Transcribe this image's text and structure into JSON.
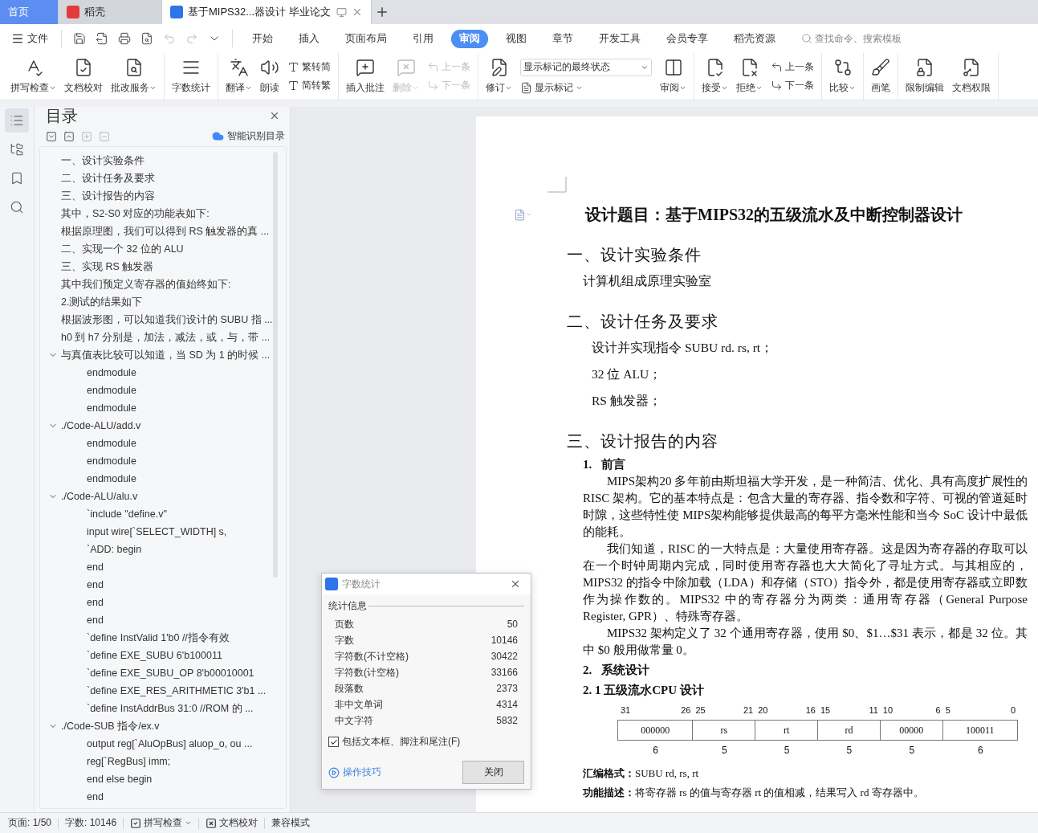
{
  "tabs": [
    {
      "kind": "home",
      "label": "首页",
      "selected": false
    },
    {
      "kind": "app",
      "label": "稻壳",
      "selected": false
    },
    {
      "kind": "doc",
      "label": "基于MIPS32...器设计 毕业论文",
      "selected": true
    }
  ],
  "menu": {
    "file_label": "文件",
    "search_placeholder": "查找命令、搜索模板",
    "tabs": [
      {
        "label": "开始",
        "selected": false
      },
      {
        "label": "插入",
        "selected": false
      },
      {
        "label": "页面布局",
        "selected": false
      },
      {
        "label": "引用",
        "selected": false
      },
      {
        "label": "审阅",
        "selected": true
      },
      {
        "label": "视图",
        "selected": false
      },
      {
        "label": "章节",
        "selected": false
      },
      {
        "label": "开发工具",
        "selected": false
      },
      {
        "label": "会员专享",
        "selected": false
      },
      {
        "label": "稻壳资源",
        "selected": false
      }
    ]
  },
  "ribbon": [
    {
      "items": [
        {
          "kind": "big",
          "label": "拼写检查",
          "dropdown": true,
          "disabled": false
        },
        {
          "kind": "big",
          "label": "文档校对",
          "dropdown": false,
          "disabled": false
        },
        {
          "kind": "big",
          "label": "批改服务",
          "dropdown": true,
          "disabled": false
        }
      ]
    },
    {
      "items": [
        {
          "kind": "big",
          "label": "字数统计",
          "dropdown": false,
          "disabled": false
        }
      ]
    },
    {
      "items": [
        {
          "kind": "big",
          "label": "翻译",
          "dropdown": true,
          "disabled": false
        },
        {
          "kind": "big",
          "label": "朗读",
          "dropdown": false,
          "disabled": false
        },
        {
          "kind": "pair",
          "rows": [
            {
              "label": "繁转简",
              "disabled": false
            },
            {
              "label": "简转繁",
              "disabled": false
            }
          ]
        }
      ]
    },
    {
      "items": [
        {
          "kind": "big",
          "label": "插入批注",
          "dropdown": false,
          "disabled": false
        },
        {
          "kind": "big",
          "label": "删除",
          "dropdown": true,
          "disabled": true
        },
        {
          "kind": "pair",
          "rows": [
            {
              "label": "上一条",
              "disabled": true
            },
            {
              "label": "下一条",
              "disabled": true
            }
          ]
        }
      ]
    },
    {
      "items": [
        {
          "kind": "big",
          "label": "修订",
          "dropdown": true,
          "disabled": false
        },
        {
          "kind": "select",
          "value": "显示标记的最终状态",
          "label": "显示标记"
        },
        {
          "kind": "big",
          "label": "审阅",
          "dropdown": true,
          "disabled": false
        }
      ]
    },
    {
      "items": [
        {
          "kind": "big",
          "label": "接受",
          "dropdown": true,
          "disabled": false
        },
        {
          "kind": "big",
          "label": "拒绝",
          "dropdown": true,
          "disabled": false
        },
        {
          "kind": "pair",
          "rows": [
            {
              "label": "上一条",
              "disabled": false
            },
            {
              "label": "下一条",
              "disabled": false
            }
          ]
        }
      ]
    },
    {
      "items": [
        {
          "kind": "big",
          "label": "比较",
          "dropdown": true,
          "disabled": false
        }
      ]
    },
    {
      "items": [
        {
          "kind": "big",
          "label": "画笔",
          "dropdown": false,
          "disabled": false
        }
      ]
    },
    {
      "items": [
        {
          "kind": "big",
          "label": "限制编辑",
          "dropdown": false,
          "disabled": false
        },
        {
          "kind": "big",
          "label": "文档权限",
          "dropdown": false,
          "disabled": false
        }
      ]
    }
  ],
  "rail_tabs": [
    {
      "selected": true
    },
    {
      "selected": false
    },
    {
      "selected": false
    },
    {
      "selected": false
    }
  ],
  "toc": {
    "title": "目录",
    "smart_label": "智能识别目录",
    "items": [
      {
        "text": "一、设计实验条件"
      },
      {
        "text": "二、设计任务及要求"
      },
      {
        "text": "三、设计报告的内容"
      },
      {
        "text": "其中，S2-S0 对应的功能表如下:"
      },
      {
        "text": "根据原理图，我们可以得到 RS 触发器的真 ..."
      },
      {
        "text": "二、实现一个 32 位的 ALU"
      },
      {
        "text": "三、实现 RS 触发器"
      },
      {
        "text": "其中我们预定义寄存器的值始终如下:"
      },
      {
        "text": "2.测试的结果如下"
      },
      {
        "text": "根据波形图，可以知道我们设计的 SUBU 指 ..."
      },
      {
        "text": "h0 到 h7 分别是，加法，减法，或，与，带 ..."
      },
      {
        "text": "与真值表比较可以知道，当 SD 为 1 的时候 ...",
        "expanded": true,
        "children": [
          {
            "text": "endmodule"
          },
          {
            "text": "endmodule"
          },
          {
            "text": "endmodule"
          }
        ]
      },
      {
        "text": "./Code-ALU/add.v",
        "expanded": true,
        "children": [
          {
            "text": "endmodule"
          },
          {
            "text": "endmodule"
          },
          {
            "text": "endmodule"
          }
        ]
      },
      {
        "text": "./Code-ALU/alu.v",
        "expanded": true,
        "children": [
          {
            "text": "`include \"define.v\""
          },
          {
            "text": "input wire[`SELECT_WIDTH] s,"
          },
          {
            "text": "`ADD: begin"
          },
          {
            "text": "end"
          },
          {
            "text": "end"
          },
          {
            "text": "end"
          },
          {
            "text": "end"
          },
          {
            "text": "`define InstValid 1'b0  //指令有效"
          },
          {
            "text": "`define EXE_SUBU 6'b100011"
          },
          {
            "text": "`define EXE_SUBU_OP 8'b00010001"
          },
          {
            "text": "`define EXE_RES_ARITHMETIC 3'b1 ..."
          },
          {
            "text": "`define InstAddrBus 31:0 //ROM 的 ..."
          }
        ]
      },
      {
        "text": "./Code-SUB 指令/ex.v",
        "expanded": true,
        "children": [
          {
            "text": "output reg[`AluOpBus] aluop_o, ou ..."
          },
          {
            "text": "reg[`RegBus]  imm;"
          },
          {
            "text": "end else begin"
          },
          {
            "text": "end"
          }
        ]
      }
    ]
  },
  "document": {
    "blocks": [
      {
        "kind": "title",
        "text": "设计题目：基于MIPS32的五级流水及中断控制器设计"
      },
      {
        "kind": "heading",
        "text": "一、设计实验条件"
      },
      {
        "kind": "line",
        "text": "计算机组成原理实验室"
      },
      {
        "kind": "heading",
        "text": "二、设计任务及要求"
      },
      {
        "kind": "list_line",
        "text": "设计并实现指令 SUBU rd. rs, rt；"
      },
      {
        "kind": "list_line",
        "text": "32 位 ALU；"
      },
      {
        "kind": "list_line",
        "text": "RS 触发器；"
      },
      {
        "kind": "heading",
        "text": "三、设计报告的内容"
      },
      {
        "kind": "subheading",
        "text": "1.   前言"
      },
      {
        "kind": "para",
        "text": "MIPS架构20 多年前由斯坦福大学开发，是一种简洁、优化、具有高度扩展性的RISC 架构。它的基本特点是：包含大量的寄存器、指令数和字符、可视的管道延时时隙，这些特性使 MIPS架构能够提供最高的每平方毫米性能和当今 SoC 设计中最低的能耗。"
      },
      {
        "kind": "para",
        "text": "我们知道，RISC 的一大特点是：大量使用寄存器。这是因为寄存器的存取可以在一个时钟周期内完成，同时使用寄存器也大大简化了寻址方式。与其相应的，MIPS32 的指令中除加载（LDA）和存储（STO）指令外，都是使用寄存器或立即数作为操作数的。MIPS32 中的寄存器分为两类：通用寄存器（General Purpose Register, GPR）、特殊寄存器。"
      },
      {
        "kind": "para",
        "text": "MIPS32 架构定义了 32 个通用寄存器，使用 $0、$1…$31 表示，都是 32 位。其中 $0 般用做常量 0。"
      },
      {
        "kind": "subheading",
        "text": "2.   系统设计"
      },
      {
        "kind": "subheading",
        "text": "2. 1 五级流水CPU 设计"
      },
      {
        "kind": "bitfield",
        "fields": [
          {
            "hi": "31",
            "lo": "26",
            "value": "000000",
            "bits": "6"
          },
          {
            "hi": "25",
            "lo": "21",
            "value": "rs",
            "bits": "5"
          },
          {
            "hi": "20",
            "lo": "16",
            "value": "rt",
            "bits": "5"
          },
          {
            "hi": "15",
            "lo": "11",
            "value": "rd",
            "bits": "5"
          },
          {
            "hi": "10",
            "lo": "6",
            "value": "00000",
            "bits": "5"
          },
          {
            "hi": "5",
            "lo": "0",
            "value": "100011",
            "bits": "6"
          }
        ]
      },
      {
        "kind": "note",
        "text": "**汇编格式：**SUBU  rd, rs, rt"
      },
      {
        "kind": "note",
        "text": "**功能描述：**将寄存器 rs 的值与寄存器 rt 的值相减，结果写入 rd 寄存器中。"
      }
    ]
  },
  "dialog": {
    "title": "字数统计",
    "section": "统计信息",
    "rows": [
      {
        "label": "页数",
        "value": "50"
      },
      {
        "label": "字数",
        "value": "10146"
      },
      {
        "label": "字符数(不计空格)",
        "value": "30422"
      },
      {
        "label": "字符数(计空格)",
        "value": "33166"
      },
      {
        "label": "段落数",
        "value": "2373"
      },
      {
        "label": "非中文单词",
        "value": "4314"
      },
      {
        "label": "中文字符",
        "value": "5832"
      }
    ],
    "checkbox": {
      "label": "包括文本框、脚注和尾注(F)",
      "checked": true
    },
    "tips_link": "操作技巧",
    "close_button": "关闭"
  },
  "status_bar": {
    "page": "页面: 1/50",
    "words": "字数: 10146",
    "spell_check": "拼写检查",
    "proofread": "文档校对",
    "mode": "兼容模式"
  }
}
